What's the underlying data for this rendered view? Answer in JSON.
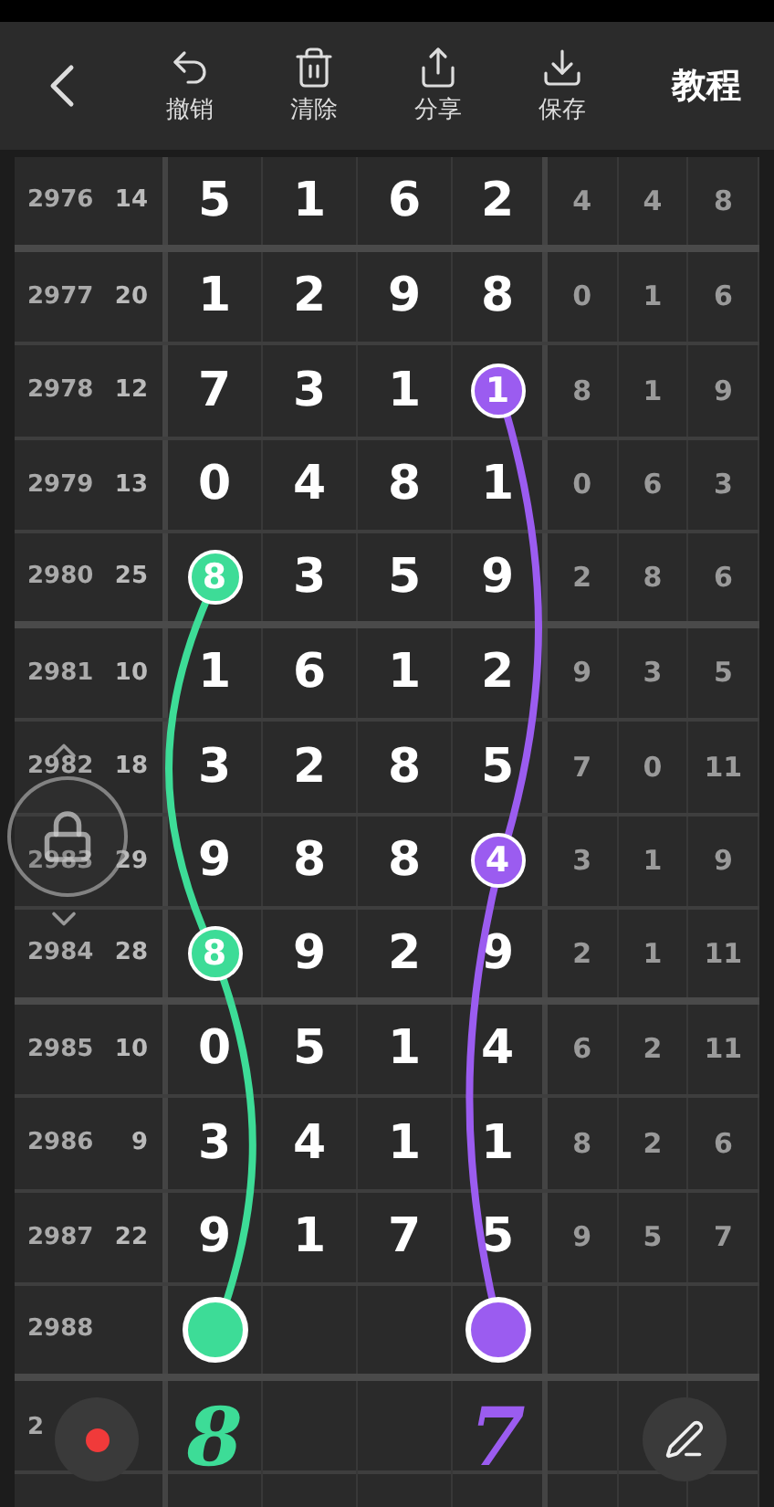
{
  "toolbar": {
    "actions": [
      {
        "kind": "undo",
        "label": "撤销"
      },
      {
        "kind": "clear",
        "label": "清除"
      },
      {
        "kind": "share",
        "label": "分享"
      },
      {
        "kind": "save",
        "label": "保存"
      }
    ],
    "tutorial": "教程"
  },
  "rows": [
    {
      "issue": "2976",
      "sum": "14",
      "digits": [
        {
          "kind": "digit",
          "value": "5"
        },
        {
          "kind": "digit",
          "value": "1"
        },
        {
          "kind": "digit",
          "value": "6"
        },
        {
          "kind": "digit",
          "value": "2"
        }
      ],
      "extra": [
        "4",
        "4",
        "8"
      ]
    },
    {
      "issue": "2977",
      "sum": "20",
      "digits": [
        {
          "kind": "digit",
          "value": "1"
        },
        {
          "kind": "digit",
          "value": "2"
        },
        {
          "kind": "digit",
          "value": "9"
        },
        {
          "kind": "digit",
          "value": "8"
        }
      ],
      "extra": [
        "0",
        "1",
        "6"
      ]
    },
    {
      "issue": "2978",
      "sum": "12",
      "digits": [
        {
          "kind": "digit",
          "value": "7"
        },
        {
          "kind": "digit",
          "value": "3"
        },
        {
          "kind": "digit",
          "value": "1"
        },
        {
          "kind": "digit",
          "value": "1",
          "color": "#9b5cf0"
        }
      ],
      "extra": [
        "8",
        "1",
        "9"
      ]
    },
    {
      "issue": "2979",
      "sum": "13",
      "digits": [
        {
          "kind": "digit",
          "value": "0"
        },
        {
          "kind": "digit",
          "value": "4"
        },
        {
          "kind": "digit",
          "value": "8"
        },
        {
          "kind": "digit",
          "value": "1"
        }
      ],
      "extra": [
        "0",
        "6",
        "3"
      ]
    },
    {
      "issue": "2980",
      "sum": "25",
      "digits": [
        {
          "kind": "digit",
          "value": "8",
          "color": "#3ddc97"
        },
        {
          "kind": "digit",
          "value": "3"
        },
        {
          "kind": "digit",
          "value": "5"
        },
        {
          "kind": "digit",
          "value": "9"
        }
      ],
      "extra": [
        "2",
        "8",
        "6"
      ]
    },
    {
      "issue": "2981",
      "sum": "10",
      "digits": [
        {
          "kind": "digit",
          "value": "1"
        },
        {
          "kind": "digit",
          "value": "6"
        },
        {
          "kind": "digit",
          "value": "1"
        },
        {
          "kind": "digit",
          "value": "2"
        }
      ],
      "extra": [
        "9",
        "3",
        "5"
      ]
    },
    {
      "issue": "2982",
      "sum": "18",
      "digits": [
        {
          "kind": "digit",
          "value": "3"
        },
        {
          "kind": "digit",
          "value": "2"
        },
        {
          "kind": "digit",
          "value": "8"
        },
        {
          "kind": "digit",
          "value": "5"
        }
      ],
      "extra": [
        "7",
        "0",
        "11"
      ]
    },
    {
      "issue": "2983",
      "sum": "29",
      "digits": [
        {
          "kind": "digit",
          "value": "9"
        },
        {
          "kind": "digit",
          "value": "8"
        },
        {
          "kind": "digit",
          "value": "8"
        },
        {
          "kind": "digit",
          "value": "4",
          "color": "#9b5cf0"
        }
      ],
      "extra": [
        "3",
        "1",
        "9"
      ]
    },
    {
      "issue": "2984",
      "sum": "28",
      "digits": [
        {
          "kind": "digit",
          "value": "8",
          "color": "#3ddc97"
        },
        {
          "kind": "digit",
          "value": "9"
        },
        {
          "kind": "digit",
          "value": "2"
        },
        {
          "kind": "digit",
          "value": "9"
        }
      ],
      "extra": [
        "2",
        "1",
        "11"
      ]
    },
    {
      "issue": "2985",
      "sum": "10",
      "digits": [
        {
          "kind": "digit",
          "value": "0"
        },
        {
          "kind": "digit",
          "value": "5"
        },
        {
          "kind": "digit",
          "value": "1"
        },
        {
          "kind": "digit",
          "value": "4"
        }
      ],
      "extra": [
        "6",
        "2",
        "11"
      ]
    },
    {
      "issue": "2986",
      "sum": "9",
      "digits": [
        {
          "kind": "digit",
          "value": "3"
        },
        {
          "kind": "digit",
          "value": "4"
        },
        {
          "kind": "digit",
          "value": "1"
        },
        {
          "kind": "digit",
          "value": "1"
        }
      ],
      "extra": [
        "8",
        "2",
        "6"
      ]
    },
    {
      "issue": "2987",
      "sum": "22",
      "digits": [
        {
          "kind": "digit",
          "value": "9"
        },
        {
          "kind": "digit",
          "value": "1"
        },
        {
          "kind": "digit",
          "value": "7"
        },
        {
          "kind": "digit",
          "value": "5"
        }
      ],
      "extra": [
        "9",
        "5",
        "7"
      ]
    },
    {
      "issue": "2988",
      "digits": [
        {
          "kind": "dot",
          "color": "#3ddc97"
        },
        {
          "kind": "blank"
        },
        {
          "kind": "blank"
        },
        {
          "kind": "dot",
          "color": "#9b5cf0"
        }
      ]
    },
    {
      "issue": "2",
      "digits": [
        {
          "kind": "note",
          "value": "8",
          "color": "#3ddc97"
        },
        {
          "kind": "blank"
        },
        {
          "kind": "blank"
        },
        {
          "kind": "note",
          "value": "7",
          "color": "#9b5cf0"
        }
      ]
    }
  ]
}
